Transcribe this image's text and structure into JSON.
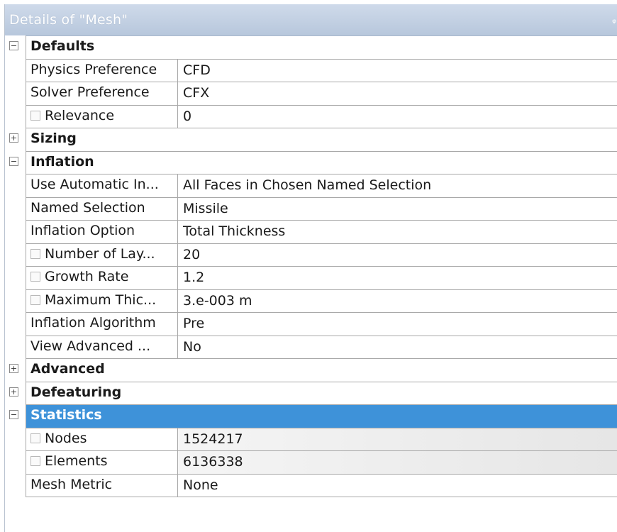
{
  "panel": {
    "title": "Details of \"Mesh\"",
    "pin_glyph": "ᵩ"
  },
  "icons": {
    "expanded": "−",
    "collapsed": "+"
  },
  "rows": {
    "defaults": {
      "label": "Defaults",
      "state": "expanded"
    },
    "physics_preference": {
      "label": "Physics Preference",
      "value": "CFD"
    },
    "solver_preference": {
      "label": "Solver Preference",
      "value": "CFX"
    },
    "relevance": {
      "label": "Relevance",
      "value": "0"
    },
    "sizing": {
      "label": "Sizing",
      "state": "collapsed"
    },
    "inflation": {
      "label": "Inflation",
      "state": "expanded"
    },
    "use_automatic_inflation": {
      "label": "Use Automatic In...",
      "value": "All Faces in Chosen Named Selection"
    },
    "named_selection": {
      "label": "Named Selection",
      "value": "Missile"
    },
    "inflation_option": {
      "label": "Inflation Option",
      "value": "Total Thickness"
    },
    "number_of_layers": {
      "label": "Number of Lay...",
      "value": "20"
    },
    "growth_rate": {
      "label": "Growth Rate",
      "value": "1.2"
    },
    "maximum_thickness": {
      "label": "Maximum Thic...",
      "value": "3.e-003 m"
    },
    "inflation_algorithm": {
      "label": "Inflation Algorithm",
      "value": "Pre"
    },
    "view_advanced": {
      "label": "View Advanced ...",
      "value": "No"
    },
    "advanced": {
      "label": "Advanced",
      "state": "collapsed"
    },
    "defeaturing": {
      "label": "Defeaturing",
      "state": "collapsed"
    },
    "statistics": {
      "label": "Statistics",
      "state": "expanded",
      "selected": true
    },
    "nodes": {
      "label": "Nodes",
      "value": "1524217"
    },
    "elements": {
      "label": "Elements",
      "value": "6136338"
    },
    "mesh_metric": {
      "label": "Mesh Metric",
      "value": "None"
    }
  },
  "colors": {
    "selection": "#3e92d9",
    "title_bar": "#c3d1e4",
    "grid_line": "#a8a8a8"
  }
}
